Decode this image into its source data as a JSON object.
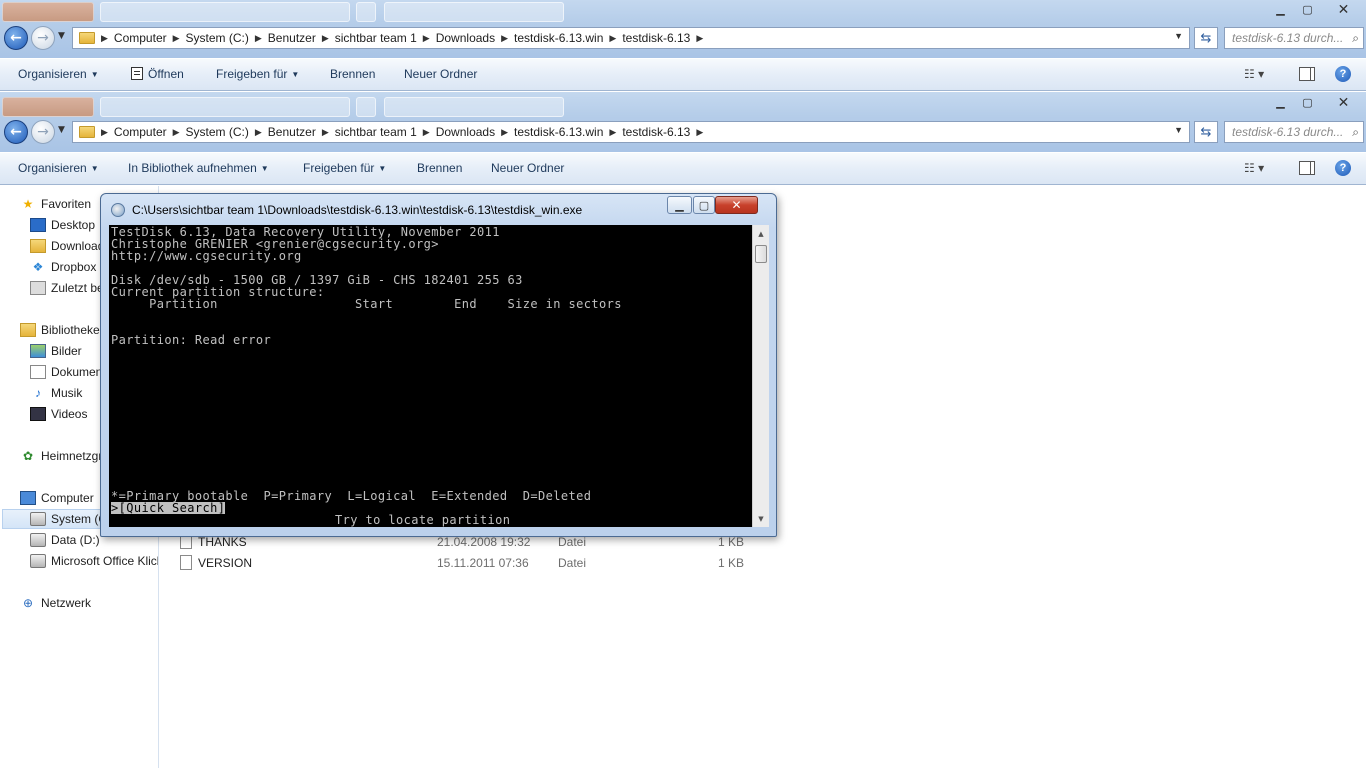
{
  "window_controls": {
    "minimize": "▁",
    "maximize": "▢",
    "close": "✕"
  },
  "nav": {
    "back": "←",
    "forward": "→"
  },
  "explorer_back": {
    "breadcrumbs": [
      "Computer",
      "System (C:)",
      "Benutzer",
      "sichtbar team 1",
      "Downloads",
      "testdisk-6.13.win",
      "testdisk-6.13"
    ],
    "search_placeholder": "testdisk-6.13 durch...",
    "toolbar": {
      "organize": "Organisieren",
      "open": "Öffnen",
      "share": "Freigeben für",
      "burn": "Brennen",
      "new_folder": "Neuer Ordner"
    }
  },
  "explorer_front": {
    "breadcrumbs": [
      "Computer",
      "System (C:)",
      "Benutzer",
      "sichtbar team 1",
      "Downloads",
      "testdisk-6.13.win",
      "testdisk-6.13"
    ],
    "search_placeholder": "testdisk-6.13 durch...",
    "toolbar": {
      "organize": "Organisieren",
      "library": "In Bibliothek aufnehmen",
      "share": "Freigeben für",
      "burn": "Brennen",
      "new_folder": "Neuer Ordner"
    }
  },
  "navpane": {
    "favorites": "Favoriten",
    "desktop": "Desktop",
    "downloads": "Downloads",
    "dropbox": "Dropbox",
    "recent": "Zuletzt be",
    "libraries": "Bibliotheken",
    "pictures": "Bilder",
    "documents": "Dokumente",
    "music": "Musik",
    "videos": "Videos",
    "homegroup": "Heimnetzgruppe",
    "computer": "Computer",
    "system": "System (C:)",
    "data": "Data (D:)",
    "office": "Microsoft Office Klick",
    "network": "Netzwerk"
  },
  "files": [
    {
      "name": "THANKS",
      "date": "21.04.2008 19:32",
      "type": "Datei",
      "size": "1 KB"
    },
    {
      "name": "VERSION",
      "date": "15.11.2011 07:36",
      "type": "Datei",
      "size": "1 KB"
    }
  ],
  "console": {
    "title": "C:\\Users\\sichtbar team 1\\Downloads\\testdisk-6.13.win\\testdisk-6.13\\testdisk_win.exe",
    "lines": {
      "l1": "TestDisk 6.13, Data Recovery Utility, November 2011",
      "l2": "Christophe GRENIER <grenier@cgsecurity.org>",
      "l3": "http://www.cgsecurity.org",
      "l4": "Disk /dev/sdb - 1500 GB / 1397 GiB - CHS 182401 255 63",
      "l5": "Current partition structure:",
      "l6": "     Partition                  Start        End    Size in sectors",
      "l7": "Partition: Read error",
      "l8": "*=Primary bootable  P=Primary  L=Logical  E=Extended  D=Deleted",
      "l9": ">[Quick Search]",
      "l10": "Try to locate partition"
    }
  }
}
